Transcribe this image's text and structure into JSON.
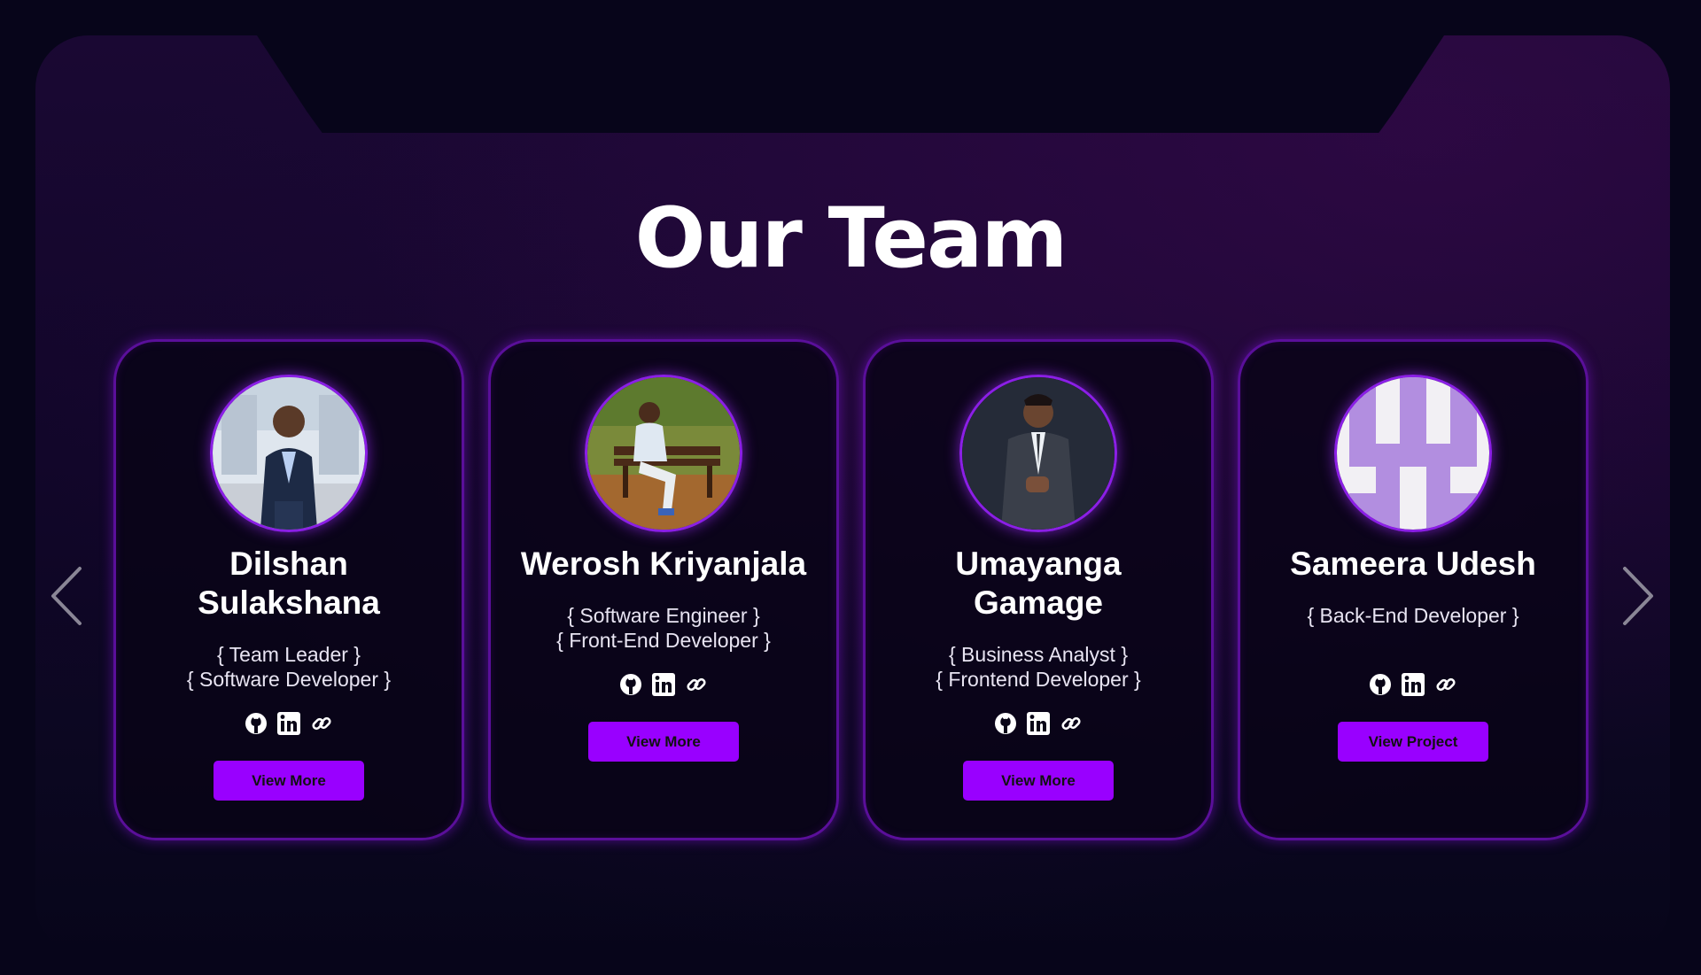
{
  "section": {
    "title": "Our Team"
  },
  "carousel": {
    "prev_icon": "chevron-left-icon",
    "next_icon": "chevron-right-icon"
  },
  "members": [
    {
      "name": "Dilshan Sulakshana",
      "roles": [
        "{ Team Leader }",
        "{ Software Developer }"
      ],
      "social_icons": [
        "github-icon",
        "linkedin-icon",
        "link-icon"
      ],
      "button": "View More"
    },
    {
      "name": "Werosh Kriyanjala",
      "roles": [
        "{ Software Engineer }",
        "{ Front-End Developer }"
      ],
      "social_icons": [
        "github-icon",
        "linkedin-icon",
        "link-icon"
      ],
      "button": "View More"
    },
    {
      "name": "Umayanga Gamage",
      "roles": [
        "{ Business Analyst }",
        "{ Frontend Developer }"
      ],
      "social_icons": [
        "github-icon",
        "linkedin-icon",
        "link-icon"
      ],
      "button": "View More"
    },
    {
      "name": "Sameera Udesh",
      "roles": [
        "{ Back-End Developer }"
      ],
      "social_icons": [
        "github-icon",
        "linkedin-icon",
        "link-icon"
      ],
      "button": "View Project"
    }
  ],
  "colors": {
    "background": "#07051a",
    "accent": "#9900ff",
    "card_border": "#5a0f9a",
    "identicon": "#b28ee0"
  }
}
